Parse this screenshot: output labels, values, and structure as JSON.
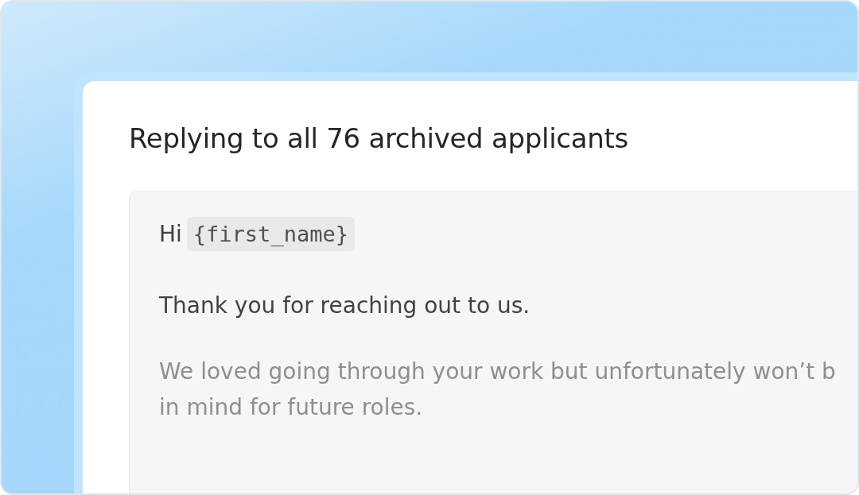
{
  "title": "Replying to all 76 archived applicants",
  "message": {
    "greeting": "Hi",
    "merge_field": "{first_name}",
    "paragraphs": [
      {
        "lines": [
          "Thank you for reaching out to us."
        ]
      },
      {
        "lines": [
          "We loved going through your work but unfortunately won’t b",
          "in mind for future roles."
        ]
      }
    ]
  }
}
